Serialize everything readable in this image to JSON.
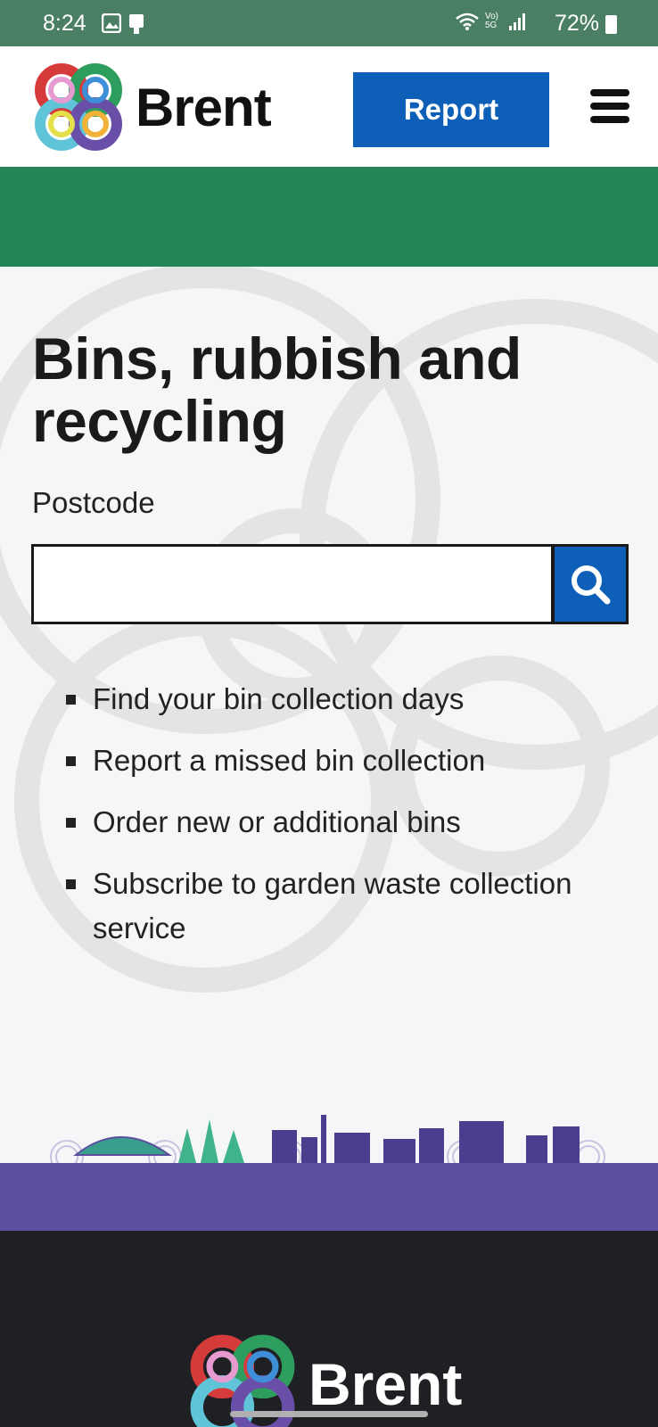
{
  "status_bar": {
    "time": "8:24",
    "network_label": "Vo) 5G",
    "battery": "72%"
  },
  "header": {
    "logo_text": "Brent",
    "report_label": "Report",
    "menu_icon": "hamburger-menu-icon"
  },
  "main": {
    "title": "Bins, rubbish and recycling",
    "postcode_label": "Postcode",
    "postcode_value": "",
    "search_icon": "search-icon",
    "links": [
      "Find your bin collection days",
      "Report a missed bin collection",
      "Order new or additional bins",
      "Subscribe to garden waste collection service"
    ]
  },
  "footer": {
    "logo_text": "Brent"
  },
  "colors": {
    "status_bar": "#4a7f63",
    "brand_blue": "#0e5fb7",
    "green_band": "#248458",
    "purple_band": "#5c4f9f",
    "footer": "#1f2024"
  }
}
